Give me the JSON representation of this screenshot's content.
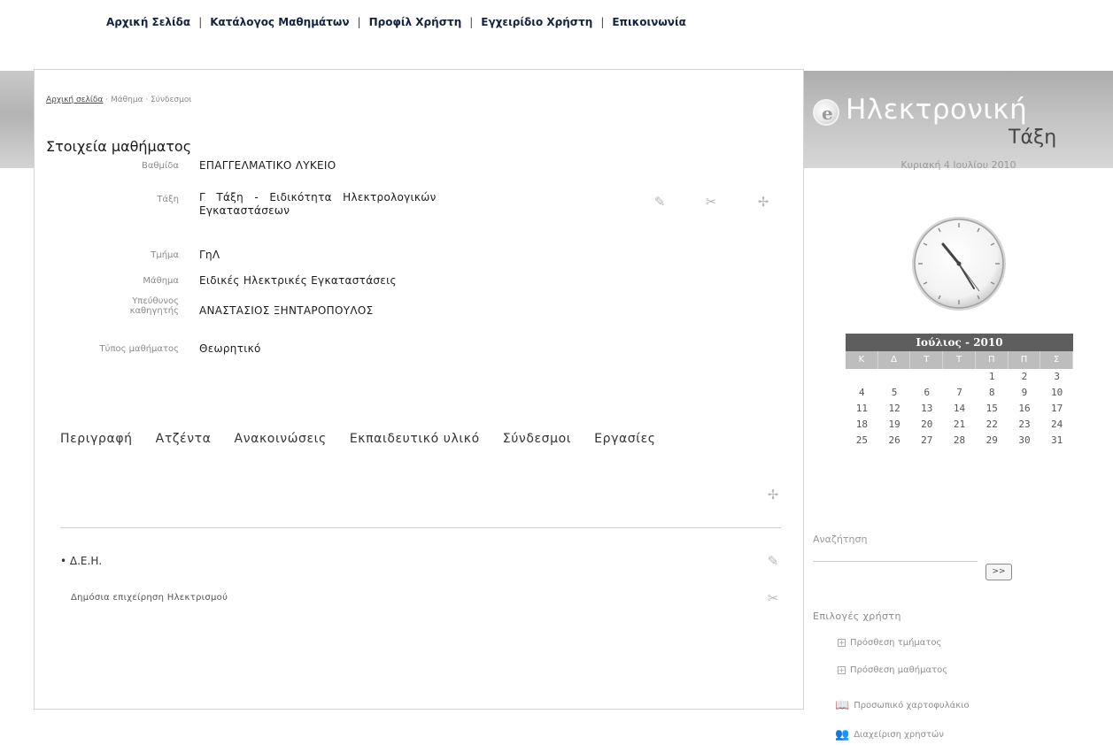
{
  "topnav": {
    "items": [
      "Αρχική Σελίδα",
      "Κατάλογος Μαθημάτων",
      "Προφίλ Χρήστη",
      "Εγχειρίδιο Χρήστη",
      "Επικοινωνία"
    ],
    "separator": "|"
  },
  "brand": {
    "line1": "Ηλεκτρονική",
    "line2": "Τάξη",
    "logo_icon": "e-logo-icon"
  },
  "breadcrumb": {
    "home": "Αρχική σελίδα",
    "rest": " · Μάθημα · Σύνδεσμοι"
  },
  "course": {
    "heading": "Στοιχεία μαθήματος",
    "fields": [
      {
        "label": "Βαθμίδα",
        "value": "ΕΠΑΓΓΕΛΜΑΤΙΚΟ ΛΥΚΕΙΟ"
      },
      {
        "label": "Τάξη",
        "value": "Γ   Τάξη   -   Ειδικότητα   Ηλεκτρολογικών",
        "value2": "Εγκαταστάσεων"
      },
      {
        "label": "Τμήμα",
        "value": "ΓηΛ"
      },
      {
        "label": "Μάθημα",
        "value": "Ειδικές Ηλεκτρικές Εγκαταστάσεις"
      },
      {
        "label": "Υπεύθυνος",
        "label2": "καθηγητής",
        "value": "ΑΝΑΣΤΑΣΙΟΣ ΞΗΝΤΑΡΟΠΟΥΛΟΣ"
      },
      {
        "label": "Τύπος μαθήματος",
        "value": "Θεωρητικό"
      }
    ]
  },
  "tabs": [
    "Περιγραφή",
    "Ατζέντα",
    "Ανακοινώσεις",
    "Εκπαιδευτικό υλικό",
    "Σύνδεσμοι",
    "Εργασίες"
  ],
  "link_entry": {
    "title": "• Δ.Ε.Η.",
    "description": "Δημόσια επιχείρηση Ηλεκτρισμού"
  },
  "sidebar": {
    "date": "Κυριακή 4 Ιουλίου 2010",
    "calendar": {
      "title": "Ιούλιος - 2010",
      "days": [
        "Κ",
        "Δ",
        "Τ",
        "Τ",
        "Π",
        "Π",
        "Σ"
      ],
      "weeks": [
        [
          "",
          "",
          "",
          "",
          "1",
          "2",
          "3"
        ],
        [
          "4",
          "5",
          "6",
          "7",
          "8",
          "9",
          "10"
        ],
        [
          "11",
          "12",
          "13",
          "14",
          "15",
          "16",
          "17"
        ],
        [
          "18",
          "19",
          "20",
          "21",
          "22",
          "23",
          "24"
        ],
        [
          "25",
          "26",
          "27",
          "28",
          "29",
          "30",
          "31"
        ]
      ]
    },
    "search": {
      "label": "Αναζήτηση",
      "value": "",
      "button": ">>"
    },
    "user_options": {
      "title": "Επιλογές χρήστη",
      "items": [
        "Πρόσθεση τμήματος",
        "Πρόσθεση μαθήματος",
        "Προσωπικό χαρτοφυλάκιο",
        "Διαχείριση χρηστών"
      ]
    }
  }
}
